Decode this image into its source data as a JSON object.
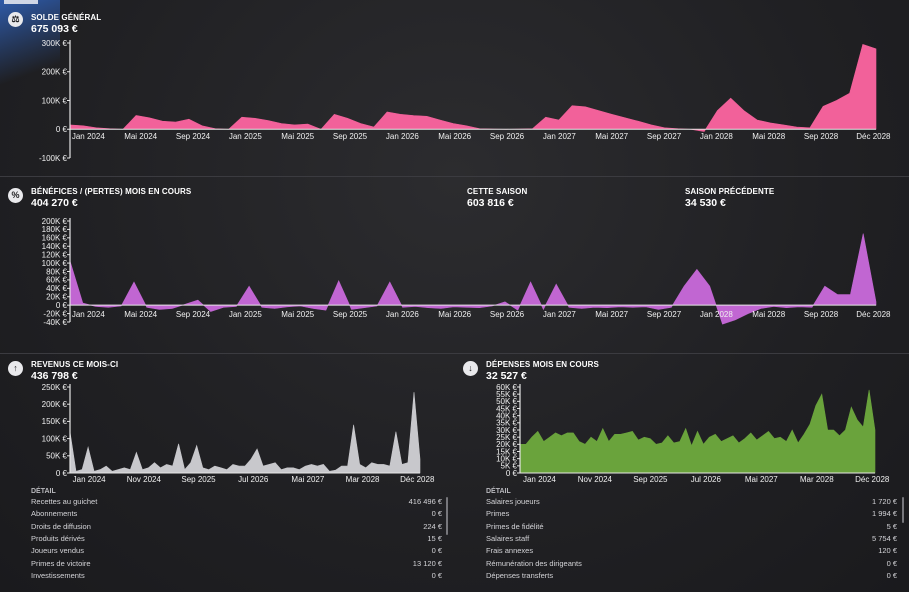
{
  "colors": {
    "pink": "#f2619a",
    "purple": "#c166d2",
    "white": "#c8c8cc",
    "green": "#6aa33c",
    "axis": "#e6e6e6"
  },
  "icons": {
    "balance": "scale-icon",
    "profit": "percent-icon",
    "revenue": "arrow-up-icon",
    "expense": "arrow-down-icon"
  },
  "balance": {
    "label": "SOLDE GÉNÉRAL",
    "value": "675 093 €"
  },
  "profit": {
    "label": "BÉNÉFICES / (PERTES) MOIS EN COURS",
    "value": "404 270 €",
    "season_label": "CETTE SAISON",
    "season_value": "603 816 €",
    "prev_label": "SAISON PRÉCÉDENTE",
    "prev_value": "34 530 €"
  },
  "revenue": {
    "label": "REVENUS CE MOIS-CI",
    "value": "436 798 €",
    "detail_title": "DÉTAIL",
    "details": [
      {
        "name": "Recettes au guichet",
        "value": "416 496 €"
      },
      {
        "name": "Abonnements",
        "value": "0 €"
      },
      {
        "name": "Droits de diffusion",
        "value": "224 €"
      },
      {
        "name": "Produits dérivés",
        "value": "15 €"
      },
      {
        "name": "Joueurs vendus",
        "value": "0 €"
      },
      {
        "name": "Primes de victoire",
        "value": "13 120 €"
      },
      {
        "name": "Investissements",
        "value": "0 €"
      }
    ]
  },
  "expense": {
    "label": "DÉPENSES MOIS EN COURS",
    "value": "32 527 €",
    "detail_title": "DÉTAIL",
    "details": [
      {
        "name": "Salaires joueurs",
        "value": "1 720 €"
      },
      {
        "name": "Primes",
        "value": "1 994 €"
      },
      {
        "name": "Primes de fidélité",
        "value": "5 €"
      },
      {
        "name": "Salaires staff",
        "value": "5 754 €"
      },
      {
        "name": "Frais annexes",
        "value": "120 €"
      },
      {
        "name": "Rémunération des dirigeants",
        "value": "0 €"
      },
      {
        "name": "Dépenses transferts",
        "value": "0 €"
      }
    ]
  },
  "chart_data": [
    {
      "id": "balance",
      "type": "area",
      "series": [
        {
          "values": [
            15,
            12,
            5,
            2,
            0,
            48,
            40,
            28,
            25,
            35,
            12,
            2,
            0,
            42,
            38,
            30,
            20,
            15,
            18,
            0,
            52,
            38,
            20,
            8,
            60,
            52,
            48,
            45,
            32,
            20,
            12,
            2,
            1,
            0,
            1,
            2,
            42,
            32,
            82,
            78,
            65,
            52,
            40,
            28,
            15,
            5,
            2,
            0,
            -8,
            65,
            108,
            65,
            32,
            22,
            15,
            8,
            5,
            80,
            100,
            125,
            295,
            280
          ]
        }
      ],
      "yticks": [
        -100000,
        0,
        100000,
        200000,
        300000
      ],
      "ytick_labels": [
        "-100K €",
        "0 €",
        "100K €",
        "200K €",
        "300K €"
      ],
      "ylim": [
        -100000,
        300000
      ],
      "xtick_labels": [
        "Jan 2024",
        "Mai 2024",
        "Sep 2024",
        "Jan 2025",
        "Mai 2025",
        "Sep 2025",
        "Jan 2026",
        "Mai 2026",
        "Sep 2026",
        "Jan 2027",
        "Mai 2027",
        "Sep 2027",
        "Jan 2028",
        "Mai 2028",
        "Sep 2028",
        "Déc 2028"
      ]
    },
    {
      "id": "profit",
      "type": "area",
      "series": [
        {
          "values": [
            105,
            5,
            -3,
            -5,
            -2,
            55,
            -5,
            -10,
            -8,
            2,
            12,
            -15,
            -5,
            -3,
            45,
            -5,
            -8,
            -4,
            -2,
            -8,
            -12,
            58,
            -10,
            -6,
            -2,
            55,
            -5,
            -3,
            -6,
            -8,
            -4,
            -5,
            -6,
            -2,
            8,
            -12,
            55,
            -10,
            50,
            -5,
            -8,
            -5,
            -6,
            -4,
            -5,
            -4,
            -10,
            -5,
            45,
            85,
            45,
            -45,
            -35,
            -20,
            -8,
            -3,
            -6,
            -4,
            -5,
            45,
            25,
            25,
            170,
            8
          ]
        }
      ],
      "yticks": [
        -40000,
        -20000,
        0,
        20000,
        40000,
        60000,
        80000,
        100000,
        120000,
        140000,
        160000,
        180000,
        200000
      ],
      "ytick_labels": [
        "-40K €",
        "-20K €",
        "0 €",
        "20K €",
        "40K €",
        "60K €",
        "80K €",
        "100K €",
        "120K €",
        "140K €",
        "160K €",
        "180K €",
        "200K €"
      ],
      "ylim": [
        -40000,
        200000
      ],
      "xtick_labels": [
        "Jan 2024",
        "Mai 2024",
        "Sep 2024",
        "Jan 2025",
        "Mai 2025",
        "Sep 2025",
        "Jan 2026",
        "Mai 2026",
        "Sep 2026",
        "Jan 2027",
        "Mai 2027",
        "Sep 2027",
        "Jan 2028",
        "Mai 2028",
        "Sep 2028",
        "Déc 2028"
      ]
    },
    {
      "id": "revenue",
      "type": "area",
      "series": [
        {
          "values": [
            120,
            5,
            10,
            75,
            5,
            10,
            20,
            5,
            10,
            15,
            10,
            60,
            10,
            15,
            30,
            15,
            25,
            20,
            85,
            10,
            30,
            80,
            15,
            10,
            20,
            15,
            10,
            25,
            20,
            20,
            40,
            70,
            20,
            25,
            30,
            10,
            15,
            15,
            10,
            20,
            25,
            20,
            25,
            5,
            8,
            20,
            20,
            140,
            25,
            15,
            30,
            25,
            25,
            20,
            120,
            25,
            30,
            235,
            40
          ]
        }
      ],
      "yticks": [
        0,
        50000,
        100000,
        150000,
        200000,
        250000
      ],
      "ytick_labels": [
        "0 €",
        "50K €",
        "100K €",
        "150K €",
        "200K €",
        "250K €"
      ],
      "ylim": [
        0,
        250000
      ],
      "xtick_labels": [
        "Jan 2024",
        "Nov 2024",
        "Sep 2025",
        "Jul 2026",
        "Mai 2027",
        "Mar 2028",
        "Déc 2028"
      ]
    },
    {
      "id": "expense",
      "type": "area",
      "series": [
        {
          "values": [
            20,
            20,
            25,
            29,
            22,
            25,
            28,
            26,
            28,
            28,
            22,
            20,
            25,
            22,
            31,
            22,
            27,
            27,
            28,
            29,
            23,
            25,
            24,
            20,
            21,
            26,
            21,
            22,
            31,
            19,
            29,
            20,
            25,
            27,
            22,
            24,
            26,
            21,
            24,
            28,
            23,
            26,
            29,
            24,
            25,
            22,
            30,
            21,
            27,
            34,
            47,
            55,
            30,
            30,
            26,
            30,
            46,
            37,
            32,
            58,
            30
          ]
        }
      ],
      "yticks": [
        0,
        5000,
        10000,
        15000,
        20000,
        25000,
        30000,
        35000,
        40000,
        45000,
        50000,
        55000,
        60000
      ],
      "ytick_labels": [
        "0 €",
        "5K €",
        "10K €",
        "15K €",
        "20K €",
        "25K €",
        "30K €",
        "35K €",
        "40K €",
        "45K €",
        "50K €",
        "55K €",
        "60K €"
      ],
      "ylim": [
        0,
        60000
      ],
      "xtick_labels": [
        "Jan 2024",
        "Nov 2024",
        "Sep 2025",
        "Jul 2026",
        "Mai 2027",
        "Mar 2028",
        "Déc 2028"
      ]
    }
  ]
}
